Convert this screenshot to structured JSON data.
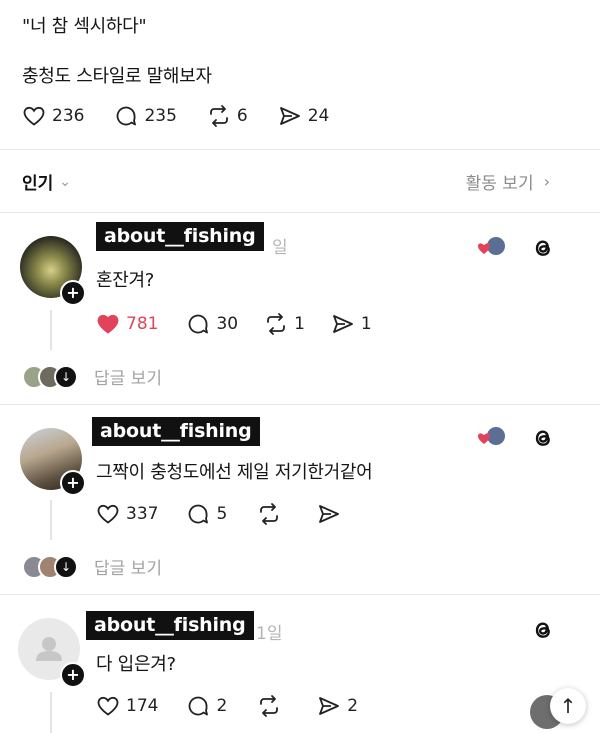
{
  "post": {
    "quote": "\"너 참 섹시하다\"",
    "line": "충청도 스타일로 말해보자",
    "likes": "236",
    "replies": "235",
    "reposts": "6",
    "shares": "24"
  },
  "sort": {
    "label": "인기",
    "activity_label": "활동 보기"
  },
  "comments": [
    {
      "username": "about__fishing",
      "time": "일",
      "text": "혼잔겨?",
      "likes": "781",
      "replies": "30",
      "reposts": "1",
      "shares": "1",
      "liked": true,
      "view_replies": "답글 보기"
    },
    {
      "username": "about__fishing",
      "time": "",
      "text": "그짝이 충청도에선 제일 저기한거같어",
      "likes": "337",
      "replies": "5",
      "reposts": "",
      "shares": "",
      "liked": false,
      "view_replies": "답글 보기"
    },
    {
      "username": "about__fishing",
      "time": "1일",
      "text": "다 입은겨?",
      "likes": "174",
      "replies": "2",
      "reposts": "",
      "shares": "2",
      "liked": false
    }
  ],
  "icons": {
    "like": "heart-icon",
    "reply": "comment-bubble-icon",
    "repost": "repost-icon",
    "share": "send-icon",
    "threads": "threads-logo-icon",
    "scroll": "arrow-up-icon"
  },
  "colors": {
    "like_active": "#e0435a",
    "muted": "#a3a3a3"
  }
}
